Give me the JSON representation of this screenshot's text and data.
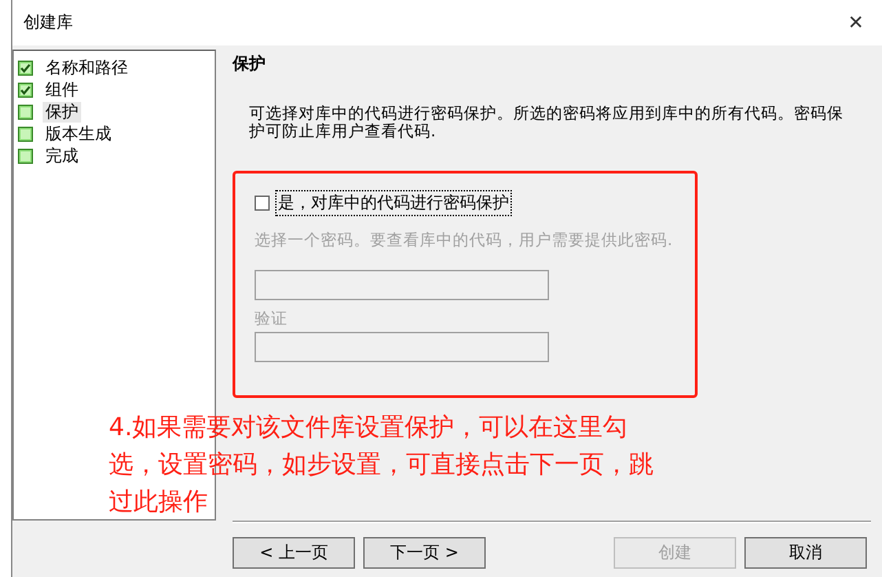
{
  "window": {
    "title": "创建库",
    "close": "✕"
  },
  "steps": [
    {
      "label": "名称和路径",
      "checked": true,
      "selected": false
    },
    {
      "label": "组件",
      "checked": true,
      "selected": false
    },
    {
      "label": "保护",
      "checked": false,
      "selected": true
    },
    {
      "label": "版本生成",
      "checked": false,
      "selected": false
    },
    {
      "label": "完成",
      "checked": false,
      "selected": false
    }
  ],
  "heading": "保护",
  "description": "可选择对库中的代码进行密码保护。所选的密码将应用到库中的所有代码。密码保护可防止库用户查看代码.",
  "protection": {
    "label": "是，对库中的代码进行密码保护",
    "checked": false,
    "hint": "选择一个密码。要查看库中的代码，用户需要提供此密码.",
    "password_disabled": true,
    "verify_label": "验证"
  },
  "annotation": "4.如果需要对该文件库设置保护，可以在这里勾选，设置密码，如步设置，可直接点击下一页，跳过此操作",
  "buttons": [
    {
      "label": "< 上一页",
      "disabled": false
    },
    {
      "label": "下一页 >",
      "disabled": false
    },
    {
      "label": "创建",
      "disabled": true
    },
    {
      "label": "取消",
      "disabled": false
    }
  ]
}
